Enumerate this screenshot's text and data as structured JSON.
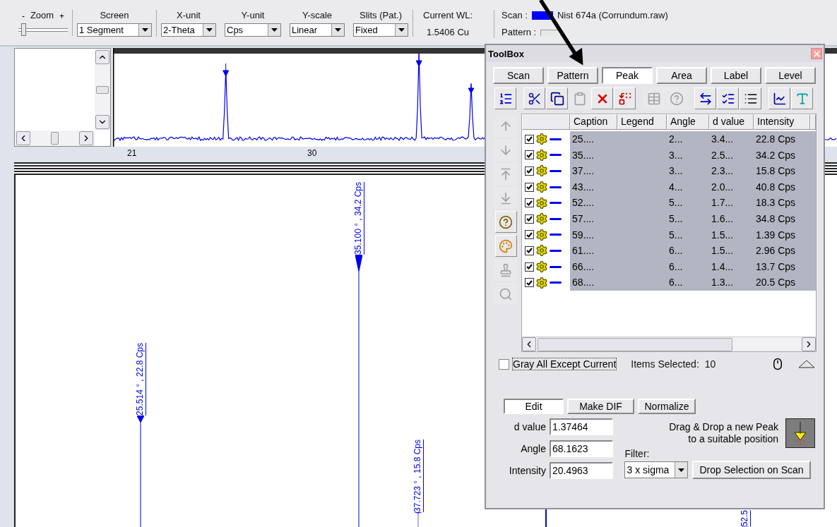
{
  "toolbar": {
    "zoom": {
      "label": "Zoom",
      "minus": "-",
      "plus": "+",
      "level": 0.05
    },
    "selects": [
      {
        "label": "Screen",
        "value": "1 Segment"
      },
      {
        "label": "X-unit",
        "value": "2-Theta"
      },
      {
        "label": "Y-unit",
        "value": "Cps"
      },
      {
        "label": "Y-scale",
        "value": "Linear"
      },
      {
        "label": "Slits (Pat.)",
        "value": "Fixed"
      }
    ],
    "current_wl": {
      "label": "Current WL:",
      "value": "1.5406 Cu"
    },
    "scan": {
      "label": "Scan :",
      "name": "Nist 674a (Corrundum.raw)"
    },
    "pattern": {
      "label": "Pattern :"
    }
  },
  "overview": {
    "axis_labels": [
      "21",
      "30"
    ]
  },
  "plot": {
    "peaks": [
      {
        "label": "25.514 ° , 22.8 Cps"
      },
      {
        "label": "35.100 ° , 34.2 Cps"
      },
      {
        "label": "37.723 ° , 15.8 Cps"
      },
      {
        "label": "52.5"
      }
    ]
  },
  "toolbox": {
    "title": "ToolBox",
    "tabs": [
      {
        "label": "Scan",
        "selected": false
      },
      {
        "label": "Pattern",
        "selected": false
      },
      {
        "label": "Peak",
        "selected": true
      },
      {
        "label": "Area",
        "selected": false
      },
      {
        "label": "Label",
        "selected": false
      },
      {
        "label": "Level",
        "selected": false
      }
    ],
    "tools": [
      {
        "kind": "list",
        "disabled": false
      },
      {
        "kind": "cut",
        "disabled": false
      },
      {
        "kind": "copy",
        "disabled": false
      },
      {
        "kind": "paste",
        "disabled": true
      },
      {
        "kind": "delete",
        "disabled": false
      },
      {
        "kind": "replace",
        "disabled": false
      },
      {
        "kind": "table",
        "disabled": true
      },
      {
        "kind": "help",
        "disabled": true
      },
      {
        "kind": "swap",
        "disabled": false
      },
      {
        "kind": "checkall",
        "disabled": false
      },
      {
        "kind": "uncheckall",
        "disabled": false
      },
      {
        "kind": "chart",
        "disabled": false
      },
      {
        "kind": "font",
        "disabled": false
      }
    ],
    "side_tools": [
      {
        "kind": "up",
        "disabled": true
      },
      {
        "kind": "down",
        "disabled": true
      },
      {
        "kind": "top",
        "disabled": true
      },
      {
        "kind": "bottom",
        "disabled": true
      },
      {
        "kind": "help",
        "disabled": false
      },
      {
        "kind": "palette",
        "disabled": false
      },
      {
        "kind": "stamp",
        "disabled": true
      },
      {
        "kind": "search",
        "disabled": true
      }
    ],
    "columns": [
      "Caption",
      "Legend",
      "Angle",
      "d value",
      "Intensity"
    ],
    "rows": [
      {
        "checked": true,
        "selected": true,
        "caption": "25....",
        "angle": "2...",
        "d": "3.4...",
        "intensity": "22.8 Cps"
      },
      {
        "checked": true,
        "selected": true,
        "caption": "35....",
        "angle": "3...",
        "d": "2.5...",
        "intensity": "34.2 Cps"
      },
      {
        "checked": true,
        "selected": true,
        "caption": "37....",
        "angle": "3...",
        "d": "2.3...",
        "intensity": "15.8 Cps"
      },
      {
        "checked": true,
        "selected": true,
        "caption": "43....",
        "angle": "4...",
        "d": "2.0...",
        "intensity": "40.8 Cps"
      },
      {
        "checked": true,
        "selected": true,
        "caption": "52....",
        "angle": "5...",
        "d": "1.7...",
        "intensity": "18.3 Cps"
      },
      {
        "checked": true,
        "selected": true,
        "caption": "57....",
        "angle": "5...",
        "d": "1.6...",
        "intensity": "34.8 Cps"
      },
      {
        "checked": true,
        "selected": true,
        "caption": "59....",
        "angle": "5...",
        "d": "1.5...",
        "intensity": "1.39 Cps"
      },
      {
        "checked": true,
        "selected": true,
        "caption": "61....",
        "angle": "6...",
        "d": "1.5...",
        "intensity": "2.96 Cps"
      },
      {
        "checked": true,
        "selected": true,
        "caption": "66....",
        "angle": "6...",
        "d": "1.4...",
        "intensity": "13.7 Cps"
      },
      {
        "checked": true,
        "selected": true,
        "caption": "68....",
        "angle": "6...",
        "d": "1.3...",
        "intensity": "20.5 Cps"
      }
    ],
    "gray_all": {
      "label": "Gray All Except Current",
      "checked": false
    },
    "items_selected": {
      "label": "Items Selected:",
      "value": "10"
    },
    "modes": [
      {
        "label": "Edit",
        "selected": true
      },
      {
        "label": "Make DIF",
        "selected": false
      },
      {
        "label": "Normalize",
        "selected": false
      }
    ],
    "fields": [
      {
        "label": "d value",
        "value": "1.37464"
      },
      {
        "label": "Angle",
        "value": "68.1623"
      },
      {
        "label": "Intensity",
        "value": "20.4963"
      }
    ],
    "drag_hint": "Drag & Drop a new Peak to a suitable position",
    "filter": {
      "label": "Filter:",
      "value": "3 x sigma"
    },
    "drop_button": "Drop Selection on Scan"
  }
}
